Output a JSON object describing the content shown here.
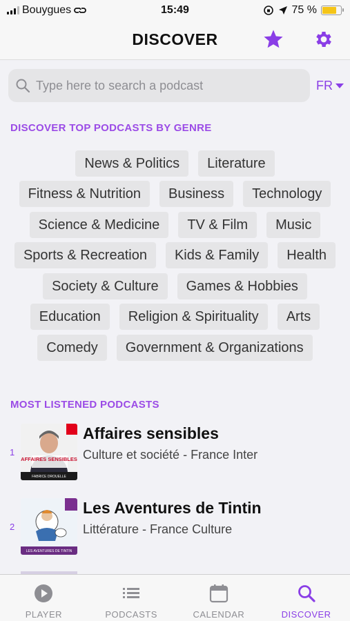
{
  "status_bar": {
    "carrier": "Bouygues",
    "time": "15:49",
    "battery": "75 %",
    "battery_level": 0.75
  },
  "header": {
    "title": "DISCOVER",
    "favorites_icon": "star-icon",
    "settings_icon": "gear-icon"
  },
  "search": {
    "placeholder": "Type here to search a podcast",
    "value": "",
    "language": "FR"
  },
  "genres": {
    "section_title": "DISCOVER TOP PODCASTS BY GENRE",
    "rows": [
      [
        "News & Politics",
        "Literature"
      ],
      [
        "Fitness & Nutrition",
        "Business",
        "Technology"
      ],
      [
        "Science & Medicine",
        "TV & Film",
        "Music"
      ],
      [
        "Sports & Recreation",
        "Kids & Family",
        "Health"
      ],
      [
        "Society & Culture",
        "Games & Hobbies"
      ],
      [
        "Education",
        "Religion & Spirituality",
        "Arts"
      ],
      [
        "Comedy",
        "Government & Organizations"
      ]
    ]
  },
  "most_listened": {
    "section_title": "MOST LISTENED PODCASTS",
    "items": [
      {
        "rank": "1",
        "title": "Affaires sensibles",
        "subtitle": "Culture et société - France Inter",
        "cover_text": "AFFAIRES SENSIBLES",
        "cover_author": "FABRICE DROUELLE"
      },
      {
        "rank": "2",
        "title": "Les Aventures de Tintin",
        "subtitle": "Littérature - France Culture",
        "cover_text": "LES AVENTURES DE TINTIN"
      }
    ]
  },
  "tabs": [
    {
      "label": "PLAYER",
      "icon": "play-icon"
    },
    {
      "label": "PODCASTS",
      "icon": "list-icon"
    },
    {
      "label": "CALENDAR",
      "icon": "calendar-icon"
    },
    {
      "label": "DISCOVER",
      "icon": "search-icon",
      "active": true
    }
  ],
  "colors": {
    "accent": "#8a3ee6",
    "section": "#9b4be6",
    "chip_bg": "#e5e5e7",
    "background": "#f2f2f6"
  }
}
